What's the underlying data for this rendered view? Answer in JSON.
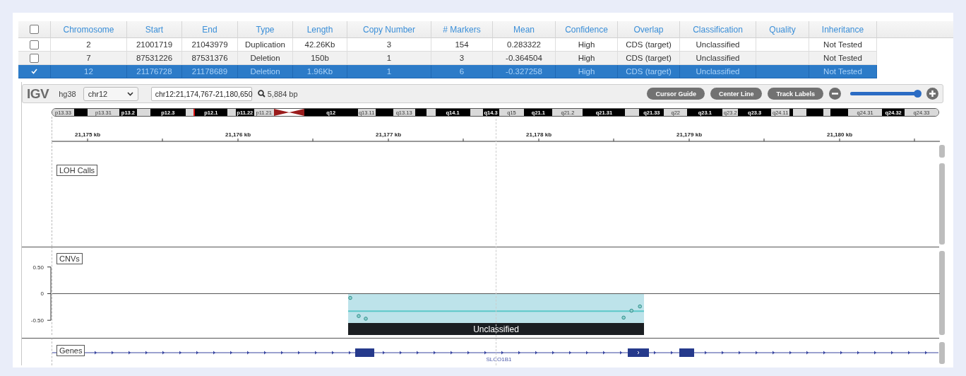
{
  "table": {
    "header_checkbox": {
      "checked": false
    },
    "columns": [
      "Chromosome",
      "Start",
      "End",
      "Type",
      "Length",
      "Copy Number",
      "# Markers",
      "Mean",
      "Confidence",
      "Overlap",
      "Classification",
      "Quality",
      "Inheritance"
    ],
    "rows": [
      {
        "checked": false,
        "selected": false,
        "cells": [
          "2",
          "21001719",
          "21043979",
          "Duplication",
          "42.26Kb",
          "3",
          "154",
          "0.283322",
          "High",
          "CDS (target)",
          "Unclassified",
          null,
          "Not Tested"
        ]
      },
      {
        "checked": false,
        "selected": false,
        "cells": [
          "7",
          "87531226",
          "87531376",
          "Deletion",
          "150b",
          "1",
          "3",
          "-0.364504",
          "High",
          "CDS (target)",
          "Unclassified",
          null,
          "Not Tested"
        ]
      },
      {
        "checked": true,
        "selected": true,
        "cells": [
          "12",
          "21176728",
          "21178689",
          "Deletion",
          "1.96Kb",
          "1",
          "6",
          "-0.327258",
          "High",
          "CDS (target)",
          "Unclassified",
          null,
          "Not Tested"
        ]
      }
    ]
  },
  "igv": {
    "toolbar": {
      "logo": "IGV",
      "genome": "hg38",
      "chromosome": "chr12",
      "locus": "chr12:21,174,767-21,180,650",
      "width_label": "5,884 bp",
      "buttons": [
        "Cursor Guide",
        "Center Line",
        "Track Labels"
      ],
      "zoom": {
        "level": 1
      }
    },
    "ideogram": [
      {
        "label": "p13.33",
        "kind": "gneg"
      },
      {
        "kind": "gpos"
      },
      {
        "label": "p13.31",
        "kind": "gneg"
      },
      {
        "label": "p13.2",
        "kind": "gpos"
      },
      {
        "kind": "gneg"
      },
      {
        "label": "p12.3",
        "kind": "gpos"
      },
      {
        "kind": "gneg"
      },
      {
        "kind": "gvar"
      },
      {
        "label": "p12.1",
        "kind": "gpos"
      },
      {
        "kind": "gneg"
      },
      {
        "label": "p11.22",
        "kind": "gpos"
      },
      {
        "label": "p11.21",
        "kind": "gneg"
      },
      {
        "kind": "acen"
      },
      {
        "label": "q12",
        "kind": "gpos"
      },
      {
        "label": "q13.11",
        "kind": "gneg"
      },
      {
        "kind": "gpos"
      },
      {
        "label": "q13.13",
        "kind": "gneg"
      },
      {
        "kind": "gpos"
      },
      {
        "kind": "gneg"
      },
      {
        "label": "q14.1",
        "kind": "gpos"
      },
      {
        "kind": "gneg"
      },
      {
        "label": "q14.3",
        "kind": "gpos"
      },
      {
        "label": "q15",
        "kind": "gneg"
      },
      {
        "label": "q21.1",
        "kind": "gpos"
      },
      {
        "label": "q21.2",
        "kind": "gneg"
      },
      {
        "label": "q21.31",
        "kind": "gpos"
      },
      {
        "kind": "gneg"
      },
      {
        "label": "q21.33",
        "kind": "gpos"
      },
      {
        "label": "q22",
        "kind": "gneg"
      },
      {
        "label": "q23.1",
        "kind": "gpos"
      },
      {
        "label": "q23.2",
        "kind": "gneg"
      },
      {
        "label": "q23.3",
        "kind": "gpos"
      },
      {
        "label": "q24.11",
        "kind": "gneg"
      },
      {
        "kind": "gpos"
      },
      {
        "kind": "gneg"
      },
      {
        "kind": "gpos"
      },
      {
        "kind": "gneg"
      },
      {
        "kind": "gpos"
      },
      {
        "label": "q24.31",
        "kind": "gneg"
      },
      {
        "label": "q24.32",
        "kind": "gpos"
      },
      {
        "label": "q24.33",
        "kind": "gneg"
      }
    ],
    "ruler": [
      "21,175 kb",
      "21,176 kb",
      "21,177 kb",
      "21,178 kb",
      "21,179 kb",
      "21,180 kb"
    ],
    "tracks": [
      {
        "kind": "loh",
        "label": "LOH Calls"
      },
      {
        "kind": "cnv",
        "label": "CNVs",
        "axis_labels": [
          "0.50",
          "0",
          "-0.50"
        ],
        "segment_label": "Unclassified"
      },
      {
        "kind": "genes",
        "label": "Genes",
        "gene": "SLCO1B1"
      }
    ]
  }
}
